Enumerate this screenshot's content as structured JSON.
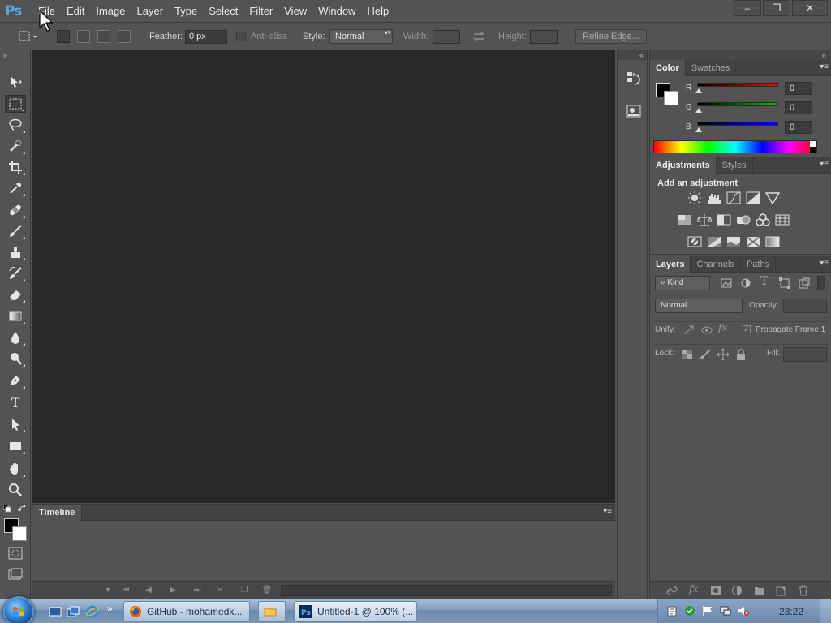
{
  "app": {
    "logo": "Ps"
  },
  "menubar": {
    "items": [
      "File",
      "Edit",
      "Image",
      "Layer",
      "Type",
      "Select",
      "Filter",
      "View",
      "Window",
      "Help"
    ]
  },
  "window_controls": {
    "minimize": "–",
    "restore": "❐",
    "close": "✕"
  },
  "options": {
    "feather_label": "Feather:",
    "feather_value": "0 px",
    "anti_alias_label": "Anti-alias",
    "style_label": "Style:",
    "style_value": "Normal",
    "width_label": "Width:",
    "height_label": "Height:",
    "refine_edge": "Refine Edge..."
  },
  "toolbar": {
    "grip": "»",
    "tools": [
      "move-tool",
      "rectangular-marquee-tool",
      "lasso-tool",
      "quick-selection-tool",
      "crop-tool",
      "eyedropper-tool",
      "spot-healing-tool",
      "brush-tool",
      "clone-stamp-tool",
      "history-brush-tool",
      "eraser-tool",
      "gradient-tool",
      "blur-tool",
      "dodge-tool",
      "pen-tool",
      "type-tool",
      "path-selection-tool",
      "rectangle-tool",
      "hand-tool",
      "zoom-tool"
    ],
    "type_tool_glyph": "T",
    "foreground_color": "#000000",
    "background_color": "#ffffff"
  },
  "timeline": {
    "tab": "Timeline",
    "menu": "▾≡",
    "controls": [
      "▾",
      "⏮",
      "◀",
      "▶",
      "⏭",
      "✂",
      "❐",
      "🗑"
    ]
  },
  "dock": {
    "grip": "«"
  },
  "panels": {
    "grip": "«",
    "color": {
      "tabs": [
        "Color",
        "Swatches"
      ],
      "menu": "▾≡",
      "channels": [
        {
          "label": "R",
          "value": "0",
          "color": "#ff0000"
        },
        {
          "label": "G",
          "value": "0",
          "color": "#00c000"
        },
        {
          "label": "B",
          "value": "0",
          "color": "#0000ff"
        }
      ]
    },
    "adjustments": {
      "tabs": [
        "Adjustments",
        "Styles"
      ],
      "menu": "▾≡",
      "title": "Add an adjustment"
    },
    "layers": {
      "tabs": [
        "Layers",
        "Channels",
        "Paths"
      ],
      "menu": "▾≡",
      "kind_label": "⌕ Kind",
      "blend_mode": "Normal",
      "opacity_label": "Opacity:",
      "unify_label": "Unify:",
      "propagate_label": "Propagate Frame 1",
      "lock_label": "Lock:",
      "fill_label": "Fill:"
    }
  },
  "taskbar": {
    "buttons": [
      {
        "label": "GitHub - mohamedk...",
        "icon": "firefox-icon"
      },
      {
        "label": "",
        "icon": "folder-icon"
      },
      {
        "label": "Untitled-1 @ 100% (...",
        "icon": "photoshop-icon"
      }
    ],
    "quicklaunch_more": "»",
    "clock": "23:22"
  }
}
